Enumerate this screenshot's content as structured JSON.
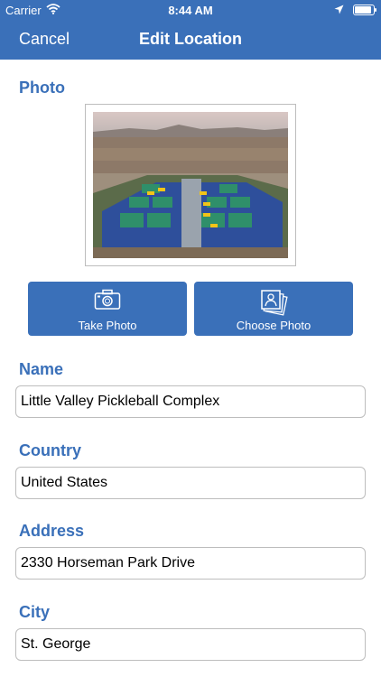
{
  "status_bar": {
    "carrier": "Carrier",
    "time": "8:44 AM",
    "icons": [
      "wifi-icon",
      "location-arrow-icon",
      "battery-icon"
    ]
  },
  "nav": {
    "cancel_label": "Cancel",
    "title": "Edit Location"
  },
  "photo_section": {
    "label": "Photo",
    "take_photo_label": "Take Photo",
    "choose_photo_label": "Choose Photo",
    "take_photo_icon": "camera-icon",
    "choose_photo_icon": "photo-stack-icon"
  },
  "fields": {
    "name": {
      "label": "Name",
      "value": "Little Valley Pickleball Complex"
    },
    "country": {
      "label": "Country",
      "value": "United States"
    },
    "address": {
      "label": "Address",
      "value": "2330 Horseman Park Drive"
    },
    "city": {
      "label": "City",
      "value": "St. George"
    }
  },
  "colors": {
    "accent": "#3a70b9",
    "background": "#ffffff",
    "field_border": "#bdbdbd"
  }
}
